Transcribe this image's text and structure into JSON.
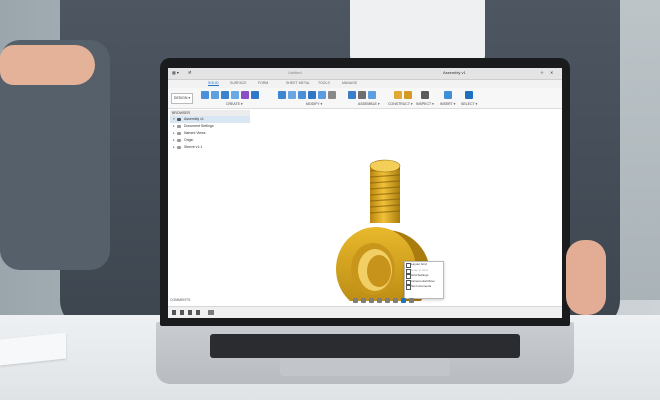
{
  "app": {
    "left_title": "Untitled",
    "right_title": "Assembly v1"
  },
  "ribbon": {
    "workspace": "DESIGN",
    "tabs": [
      {
        "label": "SOLID",
        "active": true
      },
      {
        "label": "SURFACE",
        "active": false
      },
      {
        "label": "FORM",
        "active": false
      },
      {
        "label": "SHEET METAL",
        "active": false
      },
      {
        "label": "TOOLS",
        "active": false
      },
      {
        "label": "MANAGE",
        "active": false
      }
    ],
    "groups": [
      "CREATE ▾",
      "MODIFY ▾",
      "ASSEMBLE ▾",
      "CONSTRUCT ▾",
      "INSPECT ▾",
      "INSERT ▾",
      "SELECT ▾"
    ]
  },
  "browser": {
    "title": "BROWSER",
    "root": "Assembly v1",
    "items": [
      "Document Settings",
      "Named Views",
      "Origin",
      "Sleeve v1:1"
    ]
  },
  "context_menu": {
    "items": [
      {
        "label": "Layout Grid",
        "dim": false
      },
      {
        "label": "Snap to Grid",
        "dim": true
      },
      {
        "label": "Grid Settings",
        "dim": false
      },
      {
        "label": "Incremental Move",
        "dim": false
      },
      {
        "label": "Set Increments",
        "dim": false
      }
    ]
  },
  "footer": {
    "comments": "COMMENTS"
  },
  "colors": {
    "accent": "#1a73c9",
    "part_gold": "#d9a81e",
    "part_shadow": "#a97c0d"
  }
}
